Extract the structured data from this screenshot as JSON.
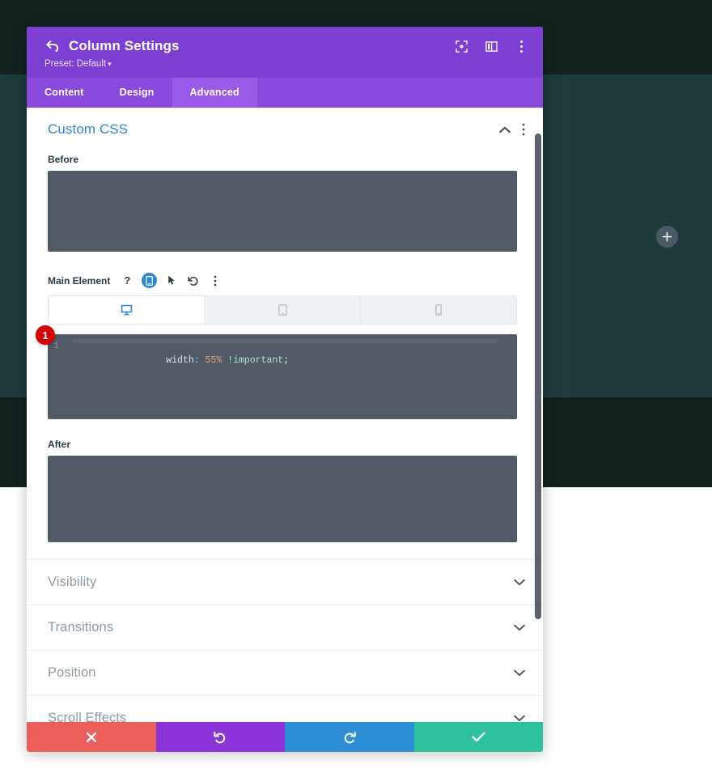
{
  "canvas": {
    "add_button_label": "+",
    "colors": {
      "dark_band": "#13211f",
      "teal_band": "#1d3b3b",
      "white_band": "#ffffff",
      "add_button_bg": "#4c5866"
    }
  },
  "modal": {
    "title": "Column Settings",
    "back_icon": "back-arrow-icon",
    "preset_label": "Preset: Default",
    "preset_caret": "▾",
    "header_tools": [
      {
        "name": "focus-target-icon",
        "label": "Focus"
      },
      {
        "name": "layout-split-icon",
        "label": "Change Layout"
      },
      {
        "name": "more-options-icon",
        "label": "More Options"
      }
    ],
    "tabs": [
      {
        "label": "Content",
        "active": false
      },
      {
        "label": "Design",
        "active": false
      },
      {
        "label": "Advanced",
        "active": true
      }
    ],
    "colors": {
      "header_bg": "#7d3ed2",
      "tab_bar_bg": "#8a4ade",
      "tab_active_bg": "#9a5ae8",
      "section_title": "#2e87cf"
    }
  },
  "custom_css": {
    "section_title": "Custom CSS",
    "collapse_icon": "chevron-up-icon",
    "more_icon": "more-options-icon",
    "before": {
      "label": "Before",
      "value": "",
      "placeholder": ""
    },
    "main_element": {
      "label": "Main Element",
      "icons": [
        {
          "name": "help-icon",
          "glyph": "?"
        },
        {
          "name": "responsive-device-icon",
          "glyph": "device",
          "active": true
        },
        {
          "name": "hover-pointer-icon",
          "glyph": "cursor"
        },
        {
          "name": "reset-undo-icon",
          "glyph": "undo"
        },
        {
          "name": "more-options-icon",
          "glyph": "dots"
        }
      ],
      "device_tabs": [
        {
          "name": "desktop",
          "icon": "desktop-icon",
          "active": true
        },
        {
          "name": "tablet",
          "icon": "tablet-icon",
          "active": false
        },
        {
          "name": "phone",
          "icon": "phone-icon",
          "active": false
        }
      ],
      "editor": {
        "line_number": "1",
        "tokens": {
          "property": "width",
          "colon": ":",
          "value": " 55%",
          "important": " !important",
          "semicolon": ";"
        },
        "full_text": "width: 55% !important;",
        "step_badge": "1"
      }
    },
    "after": {
      "label": "After",
      "value": "",
      "placeholder": ""
    }
  },
  "accordion_sections": [
    {
      "label": "Visibility",
      "chevron": "chevron-down-icon"
    },
    {
      "label": "Transitions",
      "chevron": "chevron-down-icon"
    },
    {
      "label": "Position",
      "chevron": "chevron-down-icon"
    },
    {
      "label": "Scroll Effects",
      "chevron": "chevron-down-icon"
    }
  ],
  "footer": {
    "buttons": [
      {
        "name": "cancel",
        "icon": "close-x-icon",
        "color": "#ec5e5b"
      },
      {
        "name": "undo",
        "icon": "undo-arrow-icon",
        "color": "#8b33d9"
      },
      {
        "name": "redo",
        "icon": "redo-arrow-icon",
        "color": "#2e8fd6"
      },
      {
        "name": "save",
        "icon": "checkmark-icon",
        "color": "#2ec1a0"
      }
    ]
  }
}
